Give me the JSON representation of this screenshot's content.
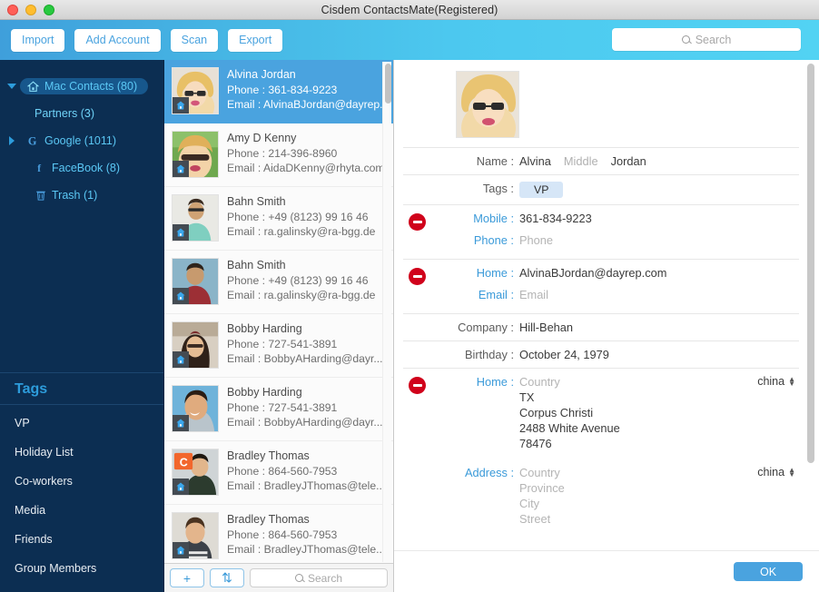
{
  "window": {
    "title": "Cisdem ContactsMate(Registered)",
    "controls": [
      "close",
      "minimize",
      "maximize"
    ]
  },
  "toolbar": {
    "buttons": [
      {
        "label": "Import",
        "name": "import-button"
      },
      {
        "label": "Add Account",
        "name": "add-account-button"
      },
      {
        "label": "Scan",
        "name": "scan-button"
      },
      {
        "label": "Export",
        "name": "export-button"
      }
    ],
    "search": {
      "placeholder": "Search",
      "value": "",
      "icon": "search-icon"
    }
  },
  "sidebar": {
    "accounts": [
      {
        "label": "Mac Contacts (80)",
        "icon": "home-icon",
        "disclosure": "down",
        "selected": true,
        "indent": false
      },
      {
        "label": "Partners (3)",
        "icon": "none",
        "disclosure": "none",
        "selected": false,
        "indent": true
      },
      {
        "label": "Google (1011)",
        "icon": "google-icon",
        "disclosure": "right",
        "selected": false,
        "indent": false
      },
      {
        "label": "FaceBook (8)",
        "icon": "facebook-icon",
        "disclosure": "none",
        "selected": false,
        "indent": false
      },
      {
        "label": "Trash (1)",
        "icon": "trash-icon",
        "disclosure": "none",
        "selected": false,
        "indent": false
      }
    ],
    "tags_title": "Tags",
    "tags": [
      "VP",
      "Holiday List",
      "Co-workers",
      "Media",
      "Friends",
      "Group Members"
    ]
  },
  "contact_list": {
    "items": [
      {
        "name": "Alvina Jordan",
        "phone": "Phone : 361-834-9223",
        "email": "Email : AlvinaBJordan@dayrep.",
        "selected": true,
        "badge": "home-icon",
        "avatar": "woman-blonde-glasses"
      },
      {
        "name": "Amy D Kenny",
        "phone": "Phone : 214-396-8960",
        "email": "Email : AidaDKenny@rhyta.com",
        "selected": false,
        "badge": "home-icon",
        "avatar": "woman-sunglasses"
      },
      {
        "name": "Bahn Smith",
        "phone": "Phone : +49 (8123) 99 16 46",
        "email": "Email : ra.galinsky@ra-bgg.de",
        "selected": false,
        "badge": "home-icon",
        "avatar": "man-green-shirt"
      },
      {
        "name": "Bahn Smith",
        "phone": "Phone : +49 (8123) 99 16 46",
        "email": "Email : ra.galinsky@ra-bgg.de",
        "selected": false,
        "badge": "home-icon",
        "avatar": "man-red-shirt"
      },
      {
        "name": "Bobby Harding",
        "phone": "Phone : 727-541-3891",
        "email": "Email : BobbyAHarding@dayr...",
        "selected": false,
        "badge": "home-icon",
        "avatar": "woman-dark-hair"
      },
      {
        "name": "Bobby Harding",
        "phone": "Phone : 727-541-3891",
        "email": "Email : BobbyAHarding@dayr...",
        "selected": false,
        "badge": "home-icon",
        "avatar": "man-illustration"
      },
      {
        "name": "Bradley Thomas",
        "phone": "Phone : 864-560-7953",
        "email": "Email : BradleyJThomas@tele...",
        "selected": false,
        "badge": "home-icon",
        "avatar": "man-orange-badge"
      },
      {
        "name": "Bradley Thomas",
        "phone": "Phone : 864-560-7953",
        "email": "Email : BradleyJThomas@tele...",
        "selected": false,
        "badge": "home-icon",
        "avatar": "man-striped-shirt"
      }
    ],
    "footer": {
      "add_label": "+",
      "sort_label": "⇅",
      "search_placeholder": "Search"
    }
  },
  "detail": {
    "name_label": "Name :",
    "name_first": "Alvina",
    "name_middle_placeholder": "Middle",
    "name_last": "Jordan",
    "tags_label": "Tags :",
    "tag_chip": "VP",
    "mobile_label": "Mobile :",
    "mobile_value": "361-834-9223",
    "phone_label": "Phone :",
    "phone_placeholder": "Phone",
    "home_email_label": "Home :",
    "home_email_value": "AlvinaBJordan@dayrep.com",
    "email_label": "Email :",
    "email_placeholder": "Email",
    "company_label": "Company :",
    "company_value": "Hill-Behan",
    "birthday_label": "Birthday :",
    "birthday_value": "October 24, 1979",
    "home_addr_label": "Home :",
    "home_addr_country_placeholder": "Country",
    "home_addr_lines": [
      "TX",
      "Corpus Christi",
      "2488 White Avenue",
      "78476"
    ],
    "home_addr_country_select": "china",
    "address_label": "Address :",
    "address_placeholders": [
      "Country",
      "Province",
      "City",
      "Street"
    ],
    "address_country_select": "china",
    "ok_label": "OK"
  },
  "colors": {
    "accent_blue": "#4aa3df",
    "sidebar_bg": "#0c2e52",
    "sidebar_text": "#5bc8f5",
    "toolbar_left": "#3f9fdb",
    "toolbar_right": "#52d3f3",
    "delete_red": "#d0021b",
    "tag_chip_bg": "#d6e6f7"
  }
}
